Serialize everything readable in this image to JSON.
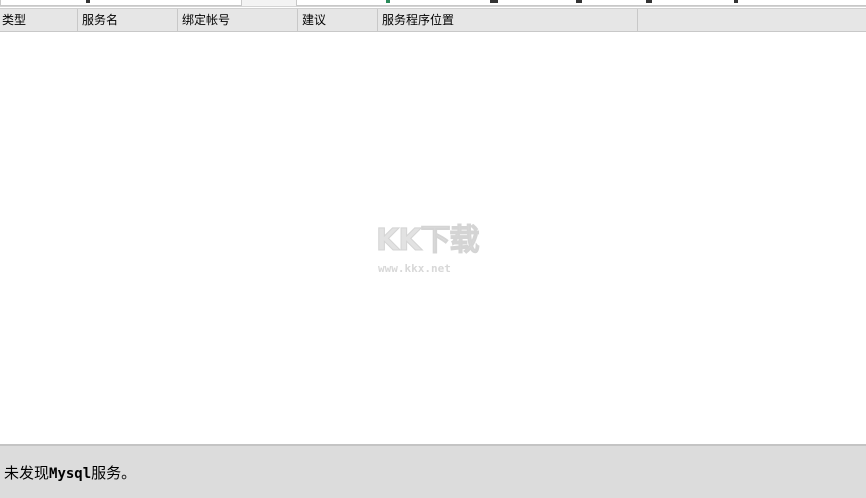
{
  "table": {
    "columns": [
      "类型",
      "服务名",
      "绑定帐号",
      "建议",
      "服务程序位置"
    ],
    "rows": []
  },
  "watermark": {
    "logo_text": "KK下载",
    "url_text": "www.kkx.net"
  },
  "status": {
    "prefix": "未发现",
    "keyword": "Mysql",
    "suffix": "服务。"
  }
}
